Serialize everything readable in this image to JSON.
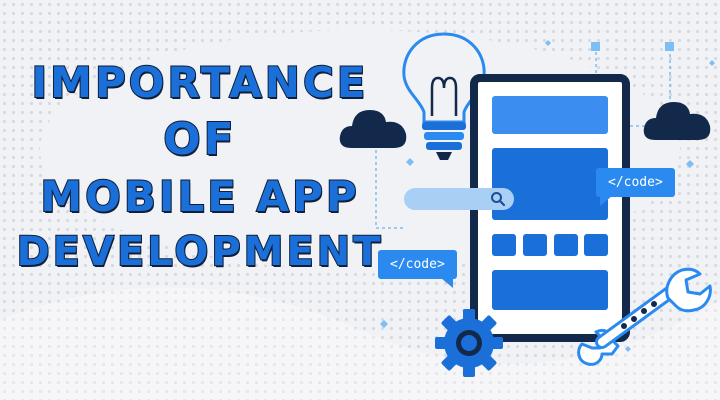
{
  "headline": {
    "line1": "IMPORTANCE",
    "line2": "OF",
    "line3": "MOBILE APP",
    "line4": "DEVELOPMENT"
  },
  "code_bubbles": {
    "left": "</code>",
    "right": "</code>"
  },
  "icons": [
    "cloud-icon",
    "lightbulb-icon",
    "search-icon",
    "gear-icon",
    "wrench-icon",
    "smartphone-icon"
  ],
  "colors": {
    "accent": "#1a6fd8",
    "dark": "#13294b",
    "light": "#3b8ef0",
    "background": "#f1f2f5"
  }
}
